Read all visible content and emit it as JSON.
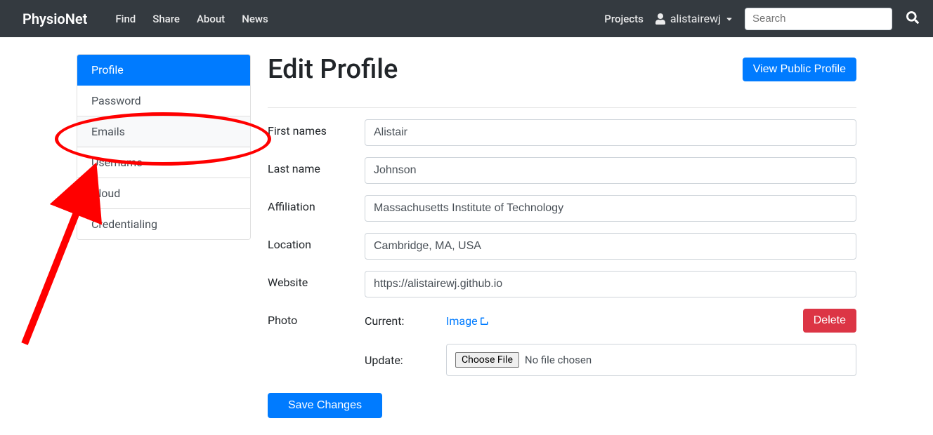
{
  "navbar": {
    "brand": "PhysioNet",
    "left_links": [
      "Find",
      "Share",
      "About",
      "News"
    ],
    "projects_link": "Projects",
    "username": "alistairewj",
    "search_placeholder": "Search"
  },
  "sidebar": {
    "items": [
      {
        "label": "Profile",
        "active": true
      },
      {
        "label": "Password"
      },
      {
        "label": "Emails",
        "highlighted": true
      },
      {
        "label": "Username"
      },
      {
        "label": "Cloud"
      },
      {
        "label": "Credentialing"
      }
    ]
  },
  "page": {
    "title": "Edit Profile",
    "view_public": "View Public Profile"
  },
  "form": {
    "first_names": {
      "label": "First names",
      "value": "Alistair"
    },
    "last_name": {
      "label": "Last name",
      "value": "Johnson"
    },
    "affiliation": {
      "label": "Affiliation",
      "value": "Massachusetts Institute of Technology"
    },
    "location": {
      "label": "Location",
      "value": "Cambridge, MA, USA"
    },
    "website": {
      "label": "Website",
      "value": "https://alistairewj.github.io"
    },
    "photo": {
      "label": "Photo",
      "current_label": "Current:",
      "image_link": "Image",
      "delete": "Delete",
      "update_label": "Update:",
      "choose_file": "Choose File",
      "no_file": "No file chosen"
    },
    "save": "Save Changes"
  }
}
